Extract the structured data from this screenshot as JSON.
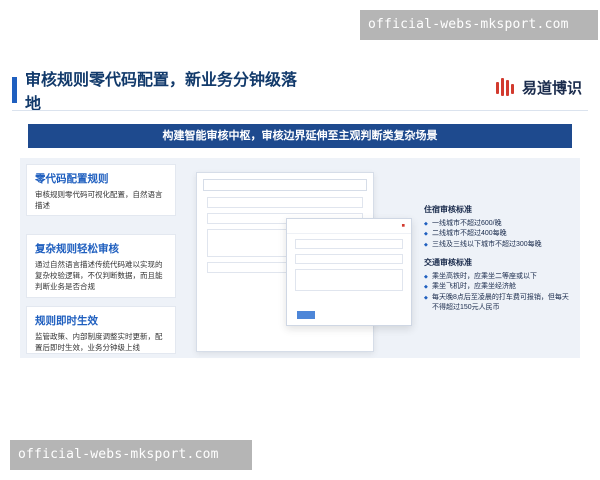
{
  "watermarks": {
    "top": "official-webs-mksport.com",
    "bottom": "official-webs-mksport.com"
  },
  "header": {
    "title": "审核规则零代码配置，新业务分钟级落地",
    "brand": "易道博识"
  },
  "banner": {
    "text": "构建智能审核中枢，审核边界延伸至主观判断类复杂场景"
  },
  "features": [
    {
      "title": "零代码配置规则",
      "desc": "审核规则零代码可视化配置，自然语言描述"
    },
    {
      "title": "复杂规则轻松审核",
      "desc": "通过自然语言描述传统代码难以实现的复杂校验逻辑，不仅判断数据，而且能判断业务是否合规"
    },
    {
      "title": "规则即时生效",
      "desc": "监管政策、内部制度调整实时更新，配置后即时生效，业务分钟级上线"
    }
  ],
  "right_panel": {
    "lodging": {
      "title": "住宿审核标准",
      "items": [
        "一线城市不超过600/晚",
        "二线城市不超过400每晚",
        "三线及三线以下城市不超过300每晚"
      ]
    },
    "transport": {
      "title": "交通审核标准",
      "items": [
        "乘坐高铁时，应乘坐二等座或以下",
        "乘坐飞机时，应乘坐经济舱",
        "每天晚8点后至凌晨的打车费可报销，但每天不得超过150元人民币"
      ]
    }
  }
}
